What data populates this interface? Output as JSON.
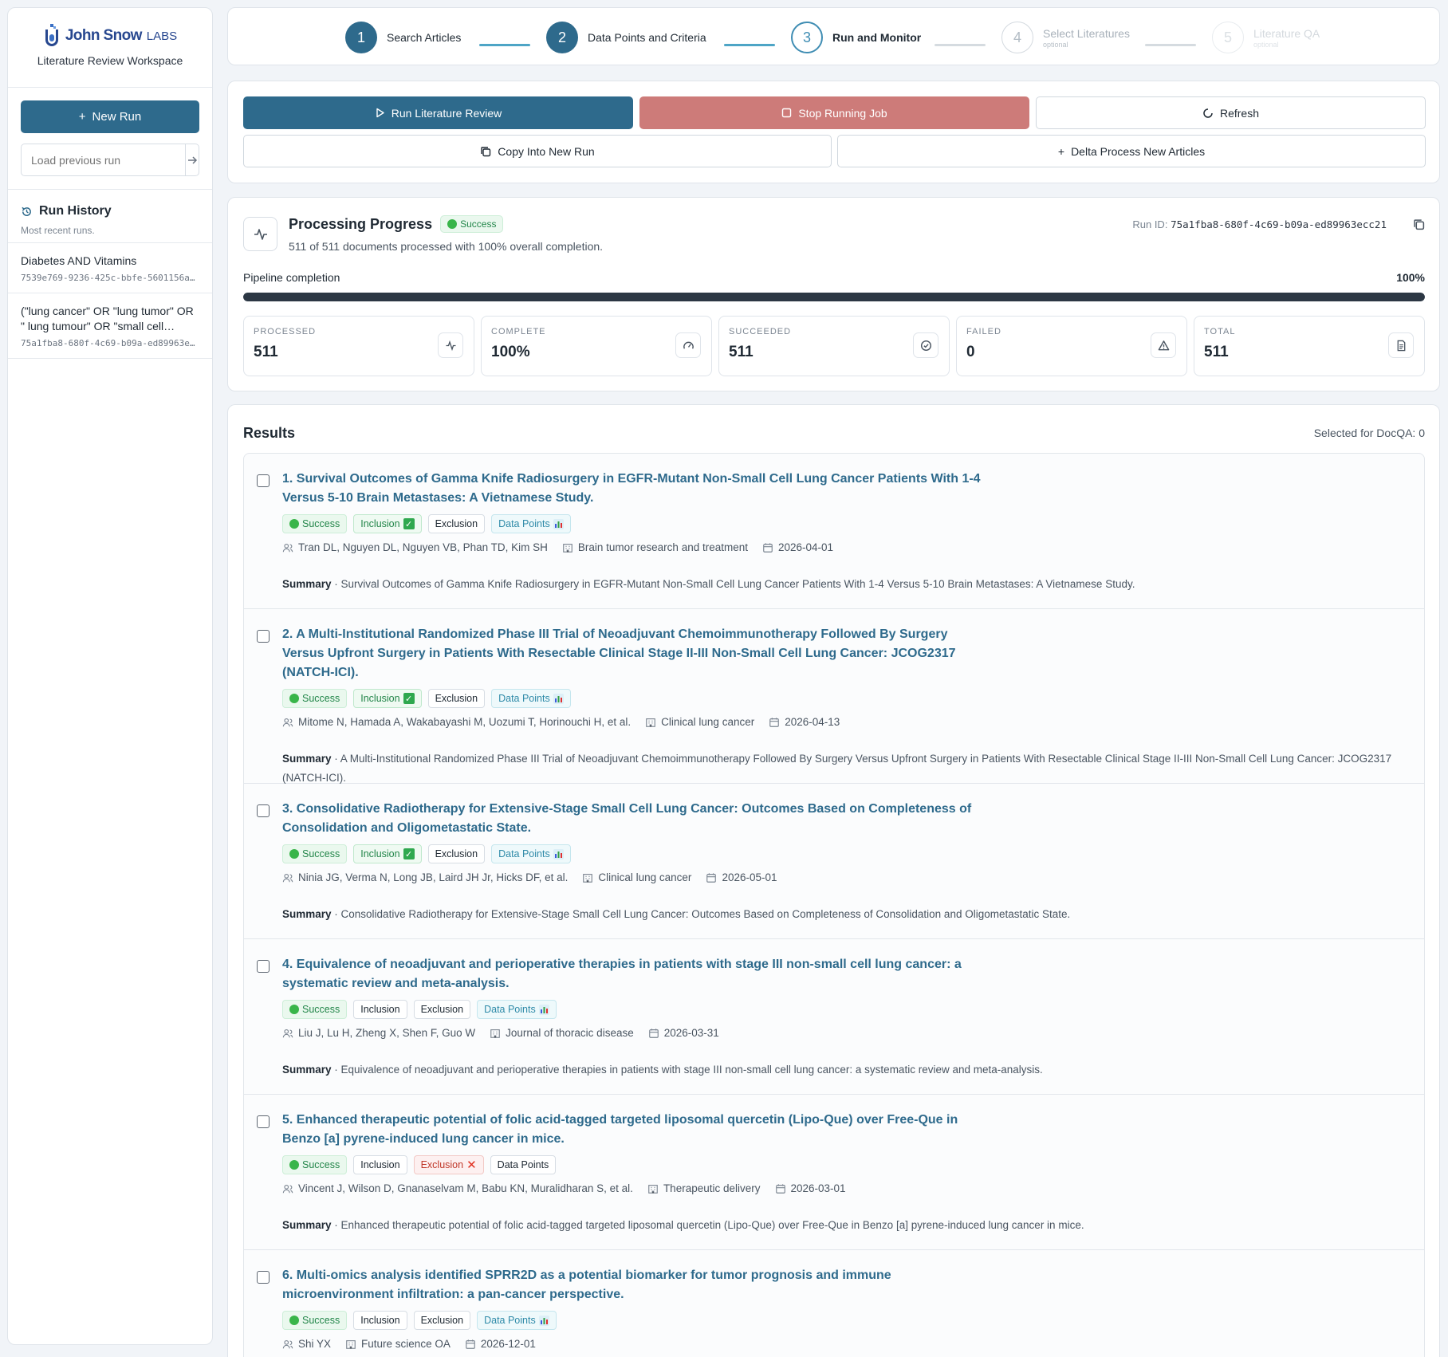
{
  "brand": {
    "name": "John Snow",
    "suffix": "LABS",
    "subtitle": "Literature Review Workspace"
  },
  "sidebar": {
    "new_run_label": "New Run",
    "load_placeholder": "Load previous run",
    "history_title": "Run History",
    "history_sub": "Most recent runs.",
    "history": [
      {
        "name": "Diabetes AND Vitamins",
        "id": "7539e769-9236-425c-bbfe-5601156a2…"
      },
      {
        "name": "(\"lung cancer\" OR \"lung tumor\" OR \" lung tumour\" OR \"small cell…",
        "id": "75a1fba8-680f-4c69-b09a-ed89963ec…"
      }
    ]
  },
  "stepper": {
    "steps": [
      {
        "num": "1",
        "label": "Search Articles",
        "optional": ""
      },
      {
        "num": "2",
        "label": "Data Points and Criteria",
        "optional": ""
      },
      {
        "num": "3",
        "label": "Run and Monitor",
        "optional": ""
      },
      {
        "num": "4",
        "label": "Select Literatures",
        "optional": "optional"
      },
      {
        "num": "5",
        "label": "Literature QA",
        "optional": "optional"
      }
    ]
  },
  "actions": {
    "run": "Run Literature Review",
    "stop": "Stop Running Job",
    "refresh": "Refresh",
    "copy": "Copy Into New Run",
    "delta": "Delta Process New Articles"
  },
  "progress": {
    "title": "Processing Progress",
    "status": "Success",
    "subtitle": "511 of 511 documents processed with 100% overall completion.",
    "run_id_label": "Run ID:",
    "run_id": "75a1fba8-680f-4c69-b09a-ed89963ecc21",
    "pipeline_label": "Pipeline completion",
    "pipeline_pct": "100%",
    "pipeline_fraction": 1.0,
    "stats": [
      {
        "label": "PROCESSED",
        "value": "511",
        "icon": "pulse-icon"
      },
      {
        "label": "COMPLETE",
        "value": "100%",
        "icon": "gauge-icon"
      },
      {
        "label": "SUCCEEDED",
        "value": "511",
        "icon": "check-circle-icon"
      },
      {
        "label": "FAILED",
        "value": "0",
        "icon": "warning-icon"
      },
      {
        "label": "TOTAL",
        "value": "511",
        "icon": "document-icon"
      }
    ]
  },
  "results": {
    "title": "Results",
    "selected": "Selected for DocQA: 0",
    "summary_label": "Summary",
    "tags": {
      "success": "Success",
      "inclusion": "Inclusion",
      "exclusion": "Exclusion",
      "data_points": "Data Points"
    },
    "articles": [
      {
        "title": "1. Survival Outcomes of Gamma Knife Radiosurgery in EGFR-Mutant Non-Small Cell Lung Cancer Patients With 1-4 Versus 5-10 Brain Metastases: A Vietnamese Study.",
        "inclusion": true,
        "exclusion": false,
        "data_points": true,
        "authors": "Tran DL, Nguyen DL, Nguyen VB, Phan TD, Kim SH",
        "journal": "Brain tumor research and treatment",
        "date": "2026-04-01",
        "summary": "Survival Outcomes of Gamma Knife Radiosurgery in EGFR-Mutant Non-Small Cell Lung Cancer Patients With 1-4 Versus 5-10 Brain Metastases: A Vietnamese Study."
      },
      {
        "title": "2. A Multi-Institutional Randomized Phase III Trial of Neoadjuvant Chemoimmunotherapy Followed By Surgery Versus Upfront Surgery in Patients With Resectable Clinical Stage II-III Non-Small Cell Lung Cancer: JCOG2317 (NATCH-ICI).",
        "inclusion": true,
        "exclusion": false,
        "data_points": true,
        "authors": "Mitome N, Hamada A, Wakabayashi M, Uozumi T, Horinouchi H, et al.",
        "journal": "Clinical lung cancer",
        "date": "2026-04-13",
        "summary": "A Multi-Institutional Randomized Phase III Trial of Neoadjuvant Chemoimmunotherapy Followed By Surgery Versus Upfront Surgery in Patients With Resectable Clinical Stage II-III Non-Small Cell Lung Cancer: JCOG2317 (NATCH-ICI)."
      },
      {
        "title": "3. Consolidative Radiotherapy for Extensive-Stage Small Cell Lung Cancer: Outcomes Based on Completeness of Consolidation and Oligometastatic State.",
        "inclusion": true,
        "exclusion": false,
        "data_points": true,
        "authors": "Ninia JG, Verma N, Long JB, Laird JH Jr, Hicks DF, et al.",
        "journal": "Clinical lung cancer",
        "date": "2026-05-01",
        "summary": "Consolidative Radiotherapy for Extensive-Stage Small Cell Lung Cancer: Outcomes Based on Completeness of Consolidation and Oligometastatic State."
      },
      {
        "title": "4. Equivalence of neoadjuvant and perioperative therapies in patients with stage III non-small cell lung cancer: a systematic review and meta-analysis.",
        "inclusion": false,
        "exclusion": false,
        "data_points": true,
        "authors": "Liu J, Lu H, Zheng X, Shen F, Guo W",
        "journal": "Journal of thoracic disease",
        "date": "2026-03-31",
        "summary": "Equivalence of neoadjuvant and perioperative therapies in patients with stage III non-small cell lung cancer: a systematic review and meta-analysis."
      },
      {
        "title": "5. Enhanced therapeutic potential of folic acid-tagged targeted liposomal quercetin (Lipo-Que) over Free-Que in Benzo [a] pyrene-induced lung cancer in mice.",
        "inclusion": false,
        "exclusion": true,
        "data_points": false,
        "authors": "Vincent J, Wilson D, Gnanaselvam M, Babu KN, Muralidharan S, et al.",
        "journal": "Therapeutic delivery",
        "date": "2026-03-01",
        "summary": "Enhanced therapeutic potential of folic acid-tagged targeted liposomal quercetin (Lipo-Que) over Free-Que in Benzo [a] pyrene-induced lung cancer in mice."
      },
      {
        "title": "6. Multi-omics analysis identified SPRR2D as a potential biomarker for tumor prognosis and immune microenvironment infiltration: a pan-cancer perspective.",
        "inclusion": false,
        "exclusion": false,
        "data_points": true,
        "authors": "Shi YX",
        "journal": "Future science OA",
        "date": "2026-12-01",
        "summary": ""
      }
    ]
  },
  "colors": {
    "primary": "#2e6a8c",
    "danger": "#cd7b79",
    "accent": "#4ea5c6",
    "success": "#23864a"
  }
}
